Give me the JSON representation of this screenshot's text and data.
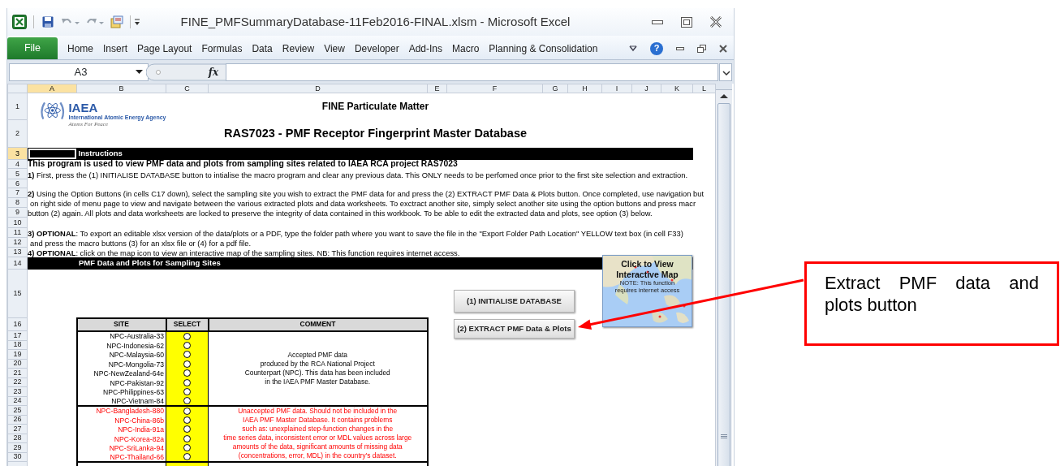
{
  "window": {
    "title": "FINE_PMFSummaryDatabase-11Feb2016-FINAL.xlsm  -  Microsoft Excel"
  },
  "ribbon": {
    "file_tab": "File",
    "tabs": [
      "Home",
      "Insert",
      "Page Layout",
      "Formulas",
      "Data",
      "Review",
      "View",
      "Developer",
      "Add-Ins",
      "Macro",
      "Planning & Consolidation"
    ],
    "help": "?"
  },
  "formula_bar": {
    "name_box": "A3",
    "function_label": "fx"
  },
  "columns": [
    {
      "label": "A",
      "selected": true
    },
    {
      "label": "B",
      "selected": false
    },
    {
      "label": "C",
      "selected": false
    },
    {
      "label": "D",
      "selected": false
    },
    {
      "label": "E",
      "selected": false
    },
    {
      "label": "F",
      "selected": false
    },
    {
      "label": "G",
      "selected": false
    },
    {
      "label": "H",
      "selected": false
    },
    {
      "label": "I",
      "selected": false
    },
    {
      "label": "J",
      "selected": false
    },
    {
      "label": "K",
      "selected": false
    },
    {
      "label": "L",
      "selected": false
    }
  ],
  "rows": [
    {
      "label": "1",
      "selected": false
    },
    {
      "label": "2",
      "selected": false
    },
    {
      "label": "3",
      "selected": true
    },
    {
      "label": "4",
      "selected": false
    },
    {
      "label": "5",
      "selected": false
    },
    {
      "label": "6",
      "selected": false
    },
    {
      "label": "7",
      "selected": false
    },
    {
      "label": "8",
      "selected": false
    },
    {
      "label": "9",
      "selected": false
    },
    {
      "label": "10",
      "selected": false
    },
    {
      "label": "11",
      "selected": false
    },
    {
      "label": "12",
      "selected": false
    },
    {
      "label": "13",
      "selected": false
    },
    {
      "label": "14",
      "selected": false
    },
    {
      "label": "15",
      "selected": false
    },
    {
      "label": "16",
      "selected": false
    },
    {
      "label": "17",
      "selected": false
    },
    {
      "label": "18",
      "selected": false
    },
    {
      "label": "19",
      "selected": false
    },
    {
      "label": "20",
      "selected": false
    },
    {
      "label": "21",
      "selected": false
    },
    {
      "label": "22",
      "selected": false
    },
    {
      "label": "23",
      "selected": false
    },
    {
      "label": "24",
      "selected": false
    },
    {
      "label": "25",
      "selected": false
    },
    {
      "label": "26",
      "selected": false
    },
    {
      "label": "27",
      "selected": false
    },
    {
      "label": "28",
      "selected": false
    },
    {
      "label": "29",
      "selected": false
    },
    {
      "label": "30",
      "selected": false
    }
  ],
  "logo": {
    "name": "IAEA",
    "subtitle": "International Atomic Energy Agency",
    "motto": "Atoms For Peace"
  },
  "titles": [
    "FINE Particulate Matter",
    "RAS7023 - PMF Receptor Fingerprint Master Database"
  ],
  "instructions": {
    "header": "Instructions",
    "lines": [
      {
        "kind": "heading",
        "text": "This program is used to view PMF data and plots from sampling sites related to IAEA RCA project RAS7023"
      },
      {
        "kind": "text",
        "text": "**1)** First, press the (1) INITIALISE DATABASE button to intialise the macro program and clear any previous data. This ONLY needs to be perfomed once prior to the first site selection and extraction."
      },
      {
        "kind": "text",
        "text": "**2)** Using the Option Buttons (in cells C17 down), select the sampling site you wish to extract the PMF data for and press the (2) EXTRACT PMF Data & Plots button. Once completed, use navigation but"
      },
      {
        "kind": "text",
        "text": "on right side of menu page to view and navigate between the various extracted plots and data worksheets. To exctract another site, simply select another site using the option buttons and press macr"
      },
      {
        "kind": "text",
        "text": "button (2) again. All plots and data worksheets are locked to preserve the integrity of data contained in this workbook. To be able to edit the extracted data and plots, see option (3) below."
      },
      {
        "kind": "text",
        "text": "**3) OPTIONAL**: To export an editable  xlsx version of the data/plots or a PDF, type the folder path where you want to save the file in the \"Export Folder Path Location\" YELLOW text box (in cell F33)"
      },
      {
        "kind": "text",
        "text": "and press the macro buttons (3) for an xlsx file or (4) for a pdf file."
      },
      {
        "kind": "text",
        "text": "**4) OPTIONAL**: click on the map icon to view an interactive map of the sampling sites. NB: This function requires internet access."
      }
    ]
  },
  "sites_section": {
    "header": "PMF Data and Plots for Sampling Sites",
    "columns": [
      "SITE",
      "SELECT",
      "COMMENT"
    ],
    "groups": [
      {
        "kind": "accepted",
        "comment_lines": [
          "Accepted PMF data",
          "produced by the RCA National Project",
          "Counterpart (NPC). This data has been included",
          "in the IAEA PMF Master Database."
        ],
        "sites": [
          {
            "name": "NPC-Australia-33",
            "selected": false
          },
          {
            "name": "NPC-Indonesia-62",
            "selected": false
          },
          {
            "name": "NPC-Malaysia-60",
            "selected": false
          },
          {
            "name": "NPC-Mongolia-73",
            "selected": false
          },
          {
            "name": "NPC-NewZealand-64e",
            "selected": false
          },
          {
            "name": "NPC-Pakistan-92",
            "selected": false
          },
          {
            "name": "NPC-Philippines-63",
            "selected": false
          },
          {
            "name": "NPC-Vietnam-84",
            "selected": false
          }
        ]
      },
      {
        "kind": "unaccepted",
        "comment_lines": [
          "Unaccepted PMF data. Should not be included in the",
          "IAEA PMF Master Database.  It contains problems",
          "such as: unexplained step-function changes in the",
          "time series data, inconsistent error or MDL values across large",
          "amounts of the data, significant amounts of missing data",
          "(concentrations, error, MDL) in the country's dataset."
        ],
        "sites": [
          {
            "name": "NPC-Bangladesh-880",
            "selected": false
          },
          {
            "name": "NPC-China-86b",
            "selected": false
          },
          {
            "name": "NPC-India-91a",
            "selected": false
          },
          {
            "name": "NPC-Korea-82a",
            "selected": false
          },
          {
            "name": "NPC-SriLanka-94",
            "selected": false
          },
          {
            "name": "NPC-Thailand-66",
            "selected": false
          }
        ]
      }
    ]
  },
  "map_button": {
    "title": "Click to View Interactive Map",
    "note": "NOTE: This function requires internet access"
  },
  "buttons": [
    "(1) INITIALISE DATABASE",
    "(2) EXTRACT PMF Data & Plots"
  ],
  "callout": "Extract PMF data and plots button"
}
